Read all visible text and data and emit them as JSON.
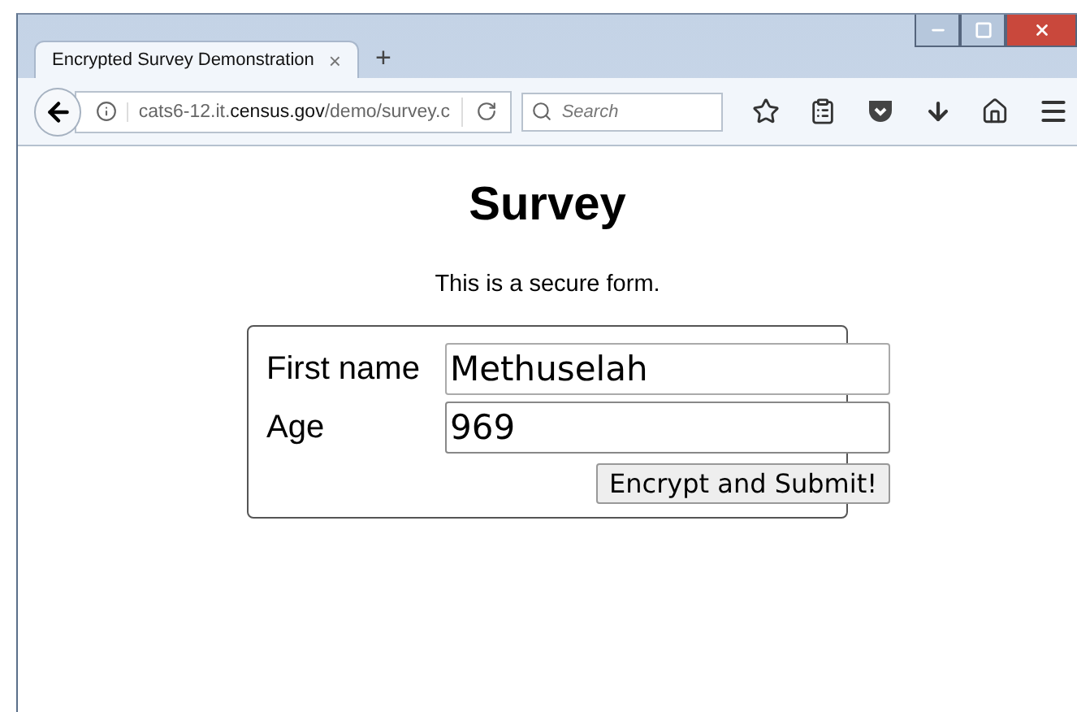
{
  "tabs": [
    {
      "label": "Encrypted Survey Demonstration",
      "close": "×",
      "selected": true
    }
  ],
  "new_tab": "+",
  "address_bar": {
    "url": "cats6-12.it.**census.gov**/demo/survey.c"
  },
  "search": {
    "placeholder": "Search"
  },
  "page": {
    "heading": "Survey",
    "intro": "This is a secure form.",
    "fields": [
      {
        "label": "First name",
        "value": "Methuselah",
        "focused": false
      },
      {
        "label": "Age",
        "value": "969",
        "focused": true
      }
    ],
    "submit": "Encrypt and Submit!"
  }
}
